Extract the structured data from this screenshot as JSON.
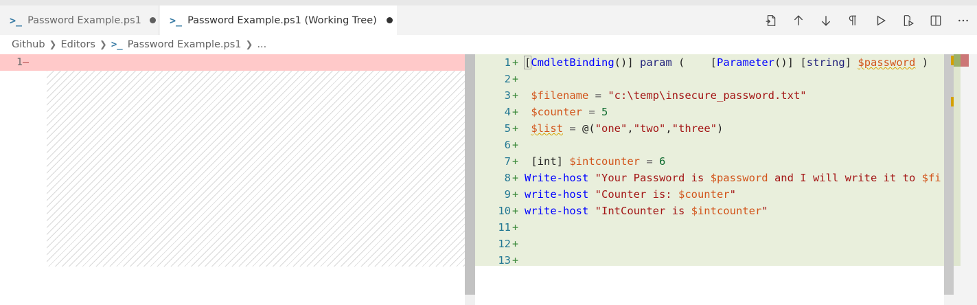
{
  "tabs": [
    {
      "label": "Password Example.ps1",
      "dirty": true,
      "active": false
    },
    {
      "label": "Password Example.ps1 (Working Tree)",
      "dirty": true,
      "active": true
    }
  ],
  "actions": [
    {
      "name": "open-file-icon"
    },
    {
      "name": "previous-change-icon"
    },
    {
      "name": "next-change-icon"
    },
    {
      "name": "whitespace-toggle-icon"
    },
    {
      "name": "run-icon"
    },
    {
      "name": "run-selection-icon"
    },
    {
      "name": "split-editor-icon"
    },
    {
      "name": "more-actions-icon"
    }
  ],
  "breadcrumb": {
    "items": [
      "Github",
      "Editors",
      "Password Example.ps1",
      "..."
    ]
  },
  "left_editor": {
    "line_number": "1",
    "marker": "—"
  },
  "right_editor": {
    "line_numbers": [
      "1",
      "2",
      "3",
      "4",
      "5",
      "6",
      "7",
      "8",
      "9",
      "10",
      "11",
      "12",
      "13"
    ],
    "marker": "+",
    "lines": [
      [
        [
          "[",
          "k-txt"
        ],
        [
          "CmdletBinding",
          "k-blue"
        ],
        [
          "()] ",
          "k-txt"
        ],
        [
          "param",
          "k-dark"
        ],
        [
          " (    ",
          "k-txt"
        ],
        [
          "[",
          "k-txt"
        ],
        [
          "Parameter",
          "k-blue"
        ],
        [
          "()] [",
          "k-txt"
        ],
        [
          "string",
          "k-dark"
        ],
        [
          "] ",
          "k-txt"
        ],
        [
          "$password",
          "k-var"
        ],
        [
          " )",
          "k-txt"
        ]
      ],
      [],
      [
        [
          " ",
          "k-txt"
        ],
        [
          "$filename",
          "k-var"
        ],
        [
          " = ",
          "k-op"
        ],
        [
          "\"c:\\temp\\insecure_password.txt\"",
          "k-str"
        ]
      ],
      [
        [
          " ",
          "k-txt"
        ],
        [
          "$counter",
          "k-var"
        ],
        [
          " = ",
          "k-op"
        ],
        [
          "5",
          "k-num"
        ]
      ],
      [
        [
          " ",
          "k-txt"
        ],
        [
          "$list",
          "k-var"
        ],
        [
          " = ",
          "k-op"
        ],
        [
          "@(",
          "k-txt"
        ],
        [
          "\"one\"",
          "k-str"
        ],
        [
          ",",
          "k-txt"
        ],
        [
          "\"two\"",
          "k-str"
        ],
        [
          ",",
          "k-txt"
        ],
        [
          "\"three\"",
          "k-str"
        ],
        [
          ")",
          "k-txt"
        ]
      ],
      [],
      [
        [
          " [int] ",
          "k-txt"
        ],
        [
          "$intcounter",
          "k-var"
        ],
        [
          " = ",
          "k-op"
        ],
        [
          "6",
          "k-num"
        ]
      ],
      [
        [
          "Write-host",
          "k-blue"
        ],
        [
          " \"Your Password is ",
          "k-str"
        ],
        [
          "$password",
          "k-var"
        ],
        [
          " and I will write it to ",
          "k-str"
        ],
        [
          "$fi",
          "k-var"
        ]
      ],
      [
        [
          "write-host",
          "k-blue"
        ],
        [
          " \"Counter is: ",
          "k-str"
        ],
        [
          "$counter",
          "k-var"
        ],
        [
          "\"",
          "k-str"
        ]
      ],
      [
        [
          "write-host",
          "k-blue"
        ],
        [
          " \"IntCounter is ",
          "k-str"
        ],
        [
          "$intcounter",
          "k-var"
        ],
        [
          "\"",
          "k-str"
        ]
      ],
      [],
      [],
      []
    ]
  }
}
